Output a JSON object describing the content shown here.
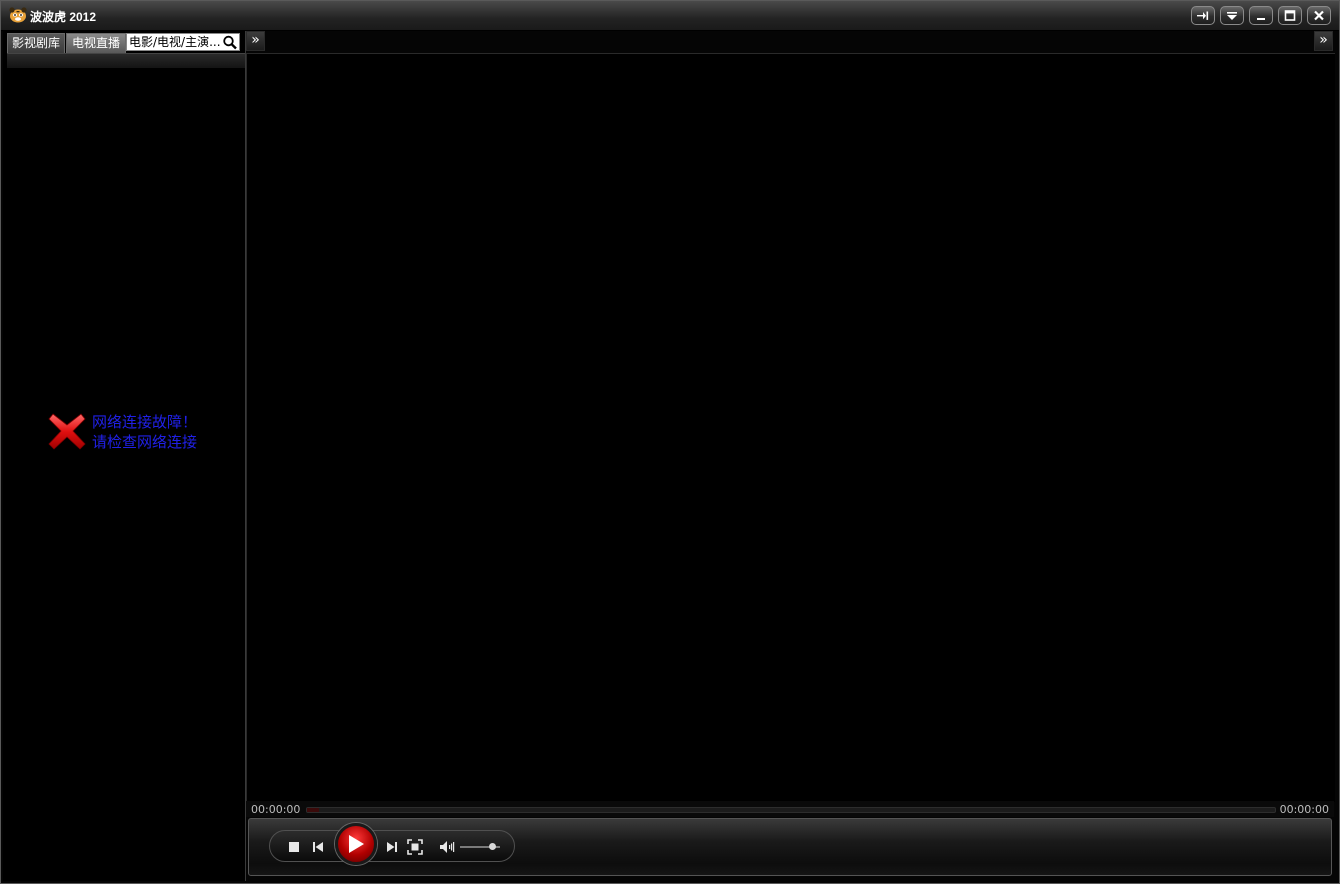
{
  "window": {
    "title": "波波虎 2012"
  },
  "title_buttons": [
    {
      "name": "pin-icon"
    },
    {
      "name": "dropdown-menu-icon"
    },
    {
      "name": "minimize-icon"
    },
    {
      "name": "maximize-icon"
    },
    {
      "name": "close-icon"
    }
  ],
  "left_panel": {
    "tabs": [
      {
        "label": "影视剧库",
        "active": false
      },
      {
        "label": "电视直播",
        "active": true
      }
    ],
    "search": {
      "placeholder": "电影/电视/主演..."
    },
    "expand_label": "»",
    "error": {
      "line1": "网络连接故障！",
      "line2": "请检查网络连接"
    }
  },
  "right_panel": {
    "expand_label": "»"
  },
  "player": {
    "elapsed": "00:00:00",
    "total": "00:00:00",
    "progress": 0,
    "volume": 0.8
  },
  "colors": {
    "error_text": "#2020e6",
    "play_button": "#d40000"
  }
}
